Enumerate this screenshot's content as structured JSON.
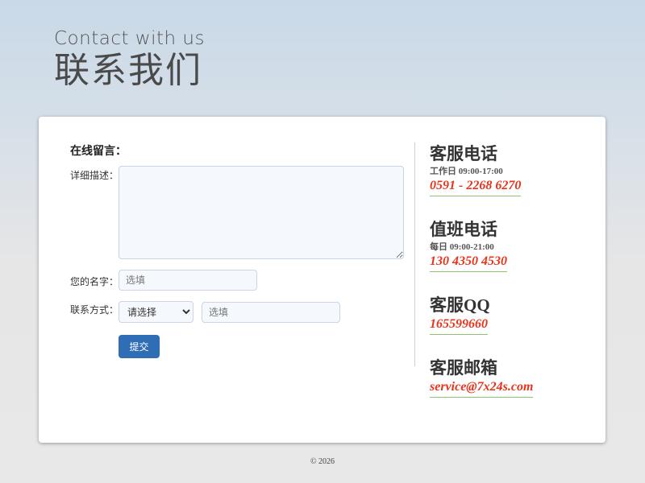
{
  "hero": {
    "english_title": "Contact with us",
    "chinese_title": "联系我们"
  },
  "form": {
    "title": "在线留言：",
    "description_label": "详细描述：",
    "name_label": "您的名字：",
    "name_placeholder": "选填",
    "contact_label": "联系方式：",
    "contact_select_value": "请选择",
    "contact_placeholder": "选填",
    "submit_label": "提交"
  },
  "contacts": [
    {
      "title": "客服电话",
      "hours": "工作日 09:00-17:00",
      "value": "0591 - 2268 6270"
    },
    {
      "title": "值班电话",
      "hours": "每日 09:00-21:00",
      "value": "130 4350 4530"
    },
    {
      "title": "客服QQ",
      "hours": "",
      "value": "165599660"
    },
    {
      "title": "客服邮箱",
      "hours": "",
      "value": "service@7x24s.com"
    }
  ],
  "colors": {
    "accent_button": "#2f6db5",
    "contact_value": "#e8331d",
    "underline": "#8cc56a"
  },
  "footer": {
    "copyright": "© 2026"
  }
}
